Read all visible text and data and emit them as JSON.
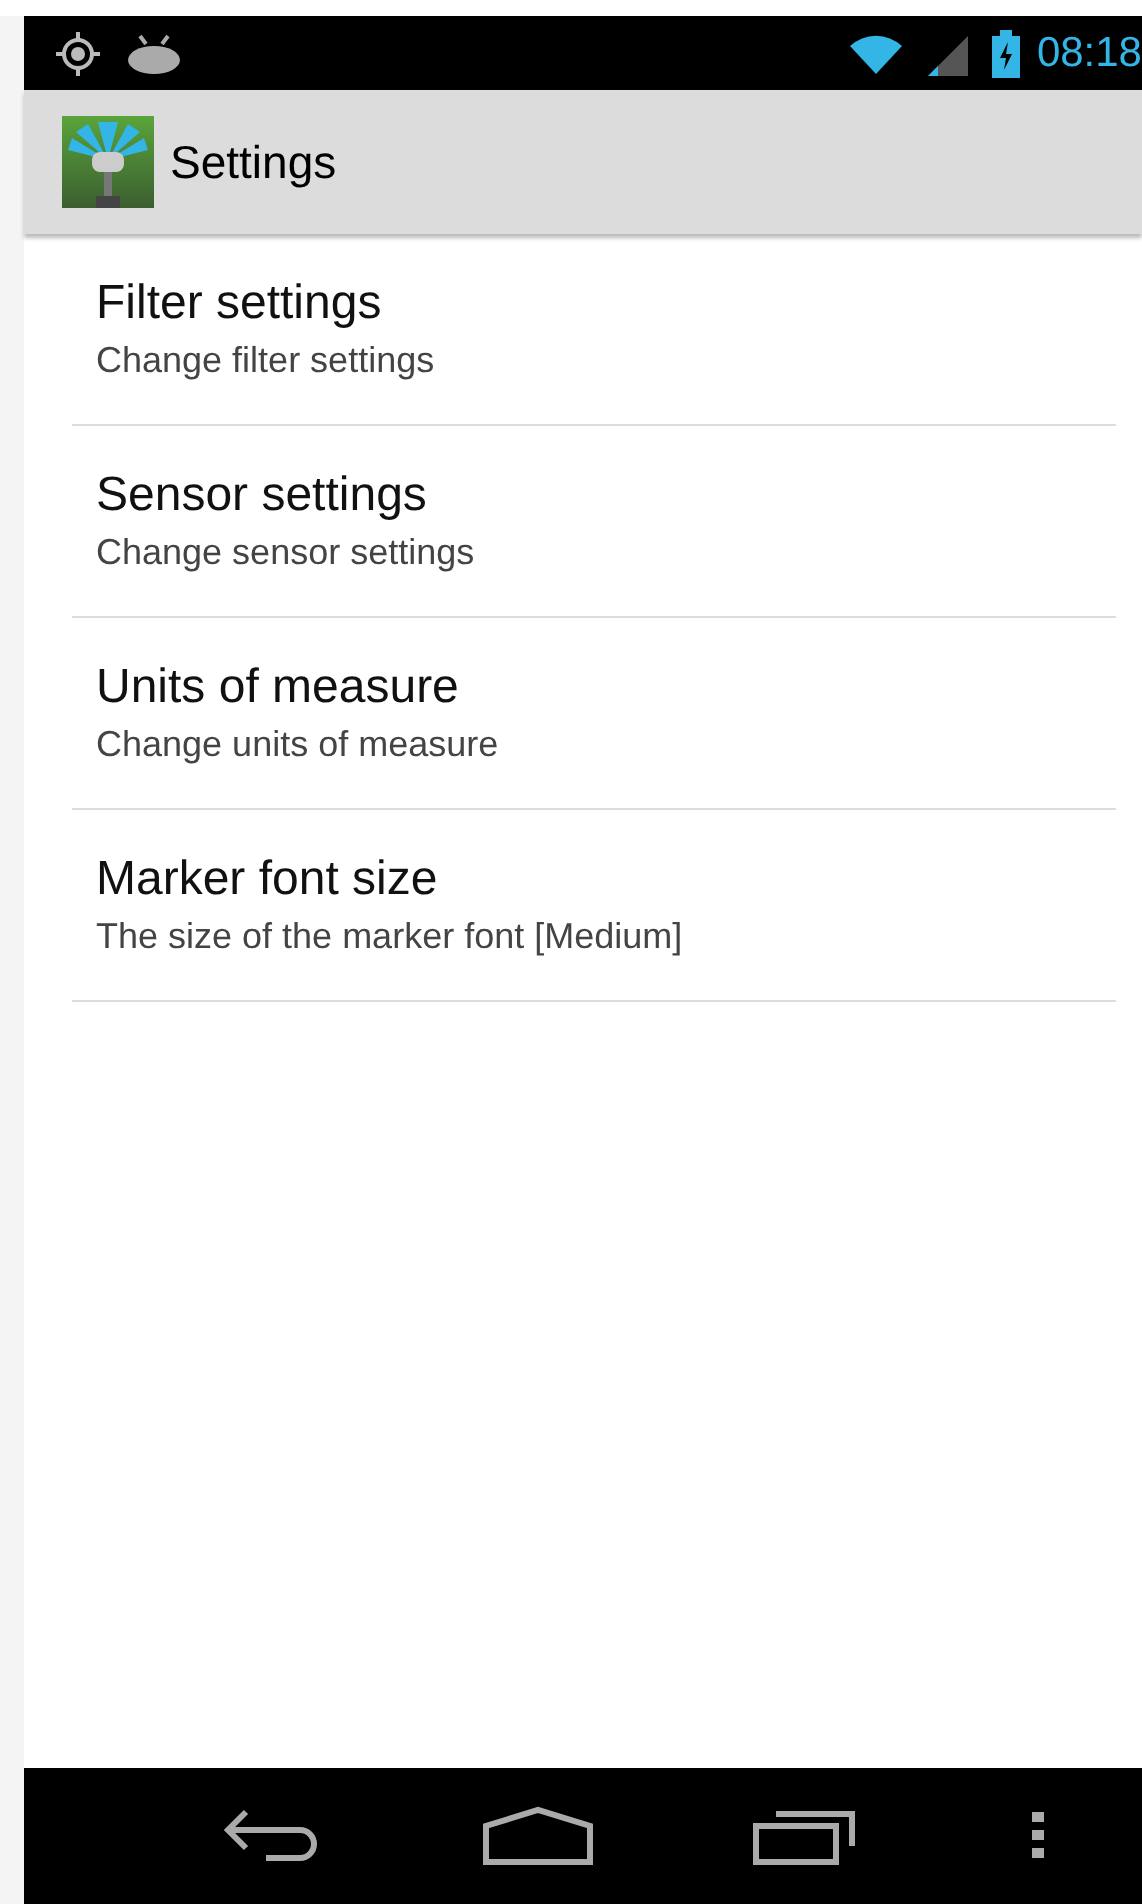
{
  "status_bar": {
    "time": "08:18"
  },
  "action_bar": {
    "title": "Settings"
  },
  "preferences": [
    {
      "title": "Filter settings",
      "summary": "Change filter settings"
    },
    {
      "title": "Sensor settings",
      "summary": "Change sensor settings"
    },
    {
      "title": "Units of measure",
      "summary": "Change units of measure"
    },
    {
      "title": "Marker font size",
      "summary": "The size of the marker font [Medium]"
    }
  ]
}
